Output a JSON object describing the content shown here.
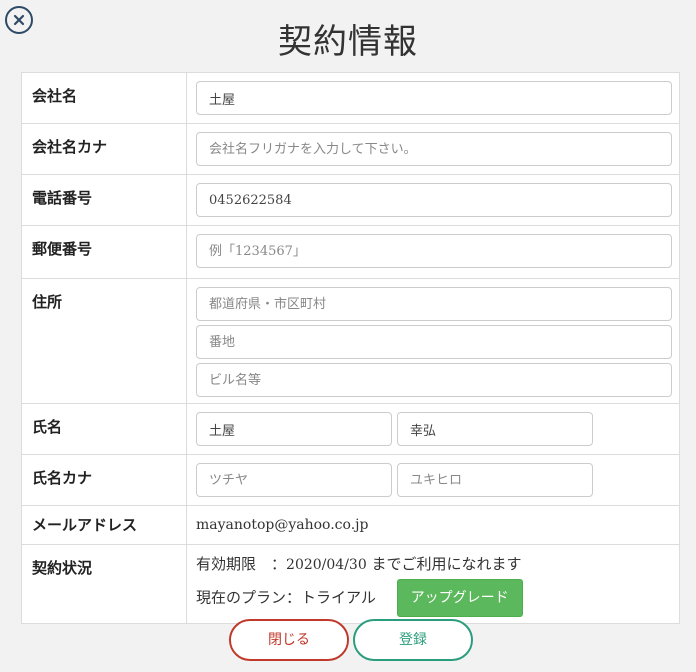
{
  "title": "契約情報",
  "icons": {
    "close": "close-circle-icon"
  },
  "rows": {
    "company_name": {
      "label": "会社名",
      "value": "土屋",
      "placeholder": ""
    },
    "company_kana": {
      "label": "会社名カナ",
      "value": "",
      "placeholder": "会社名フリガナを入力して下さい。"
    },
    "phone": {
      "label": "電話番号",
      "value": "0452622584",
      "placeholder": ""
    },
    "postal": {
      "label": "郵便番号",
      "value": "",
      "placeholder": "例「1234567」"
    },
    "address": {
      "label": "住所",
      "pref_placeholder": "都道府県・市区町村",
      "street_placeholder": "番地",
      "building_placeholder": "ビル名等"
    },
    "name": {
      "label": "氏名",
      "last": "土屋",
      "first": "幸弘"
    },
    "name_kana": {
      "label": "氏名カナ",
      "last_placeholder": "ツチヤ",
      "first_placeholder": "ユキヒロ"
    },
    "email": {
      "label": "メールアドレス",
      "value": "mayanotop@yahoo.co.jp"
    },
    "contract": {
      "label": "契約状況",
      "expiry_label": "有効期限",
      "expiry_sep": "　：",
      "expiry_date": "2020/04/30",
      "expiry_suffix": " までご利用になれます",
      "plan_label": "現在のプラン",
      "plan_sep": "：",
      "plan_value": "トライアル",
      "upgrade_label": "アップグレード"
    }
  },
  "buttons": {
    "close": "閉じる",
    "register": "登録"
  },
  "colors": {
    "close_border": "#c0392b",
    "register_border": "#2a9d7c",
    "upgrade_bg": "#5cb85c",
    "close_icon": "#2f4a66"
  }
}
